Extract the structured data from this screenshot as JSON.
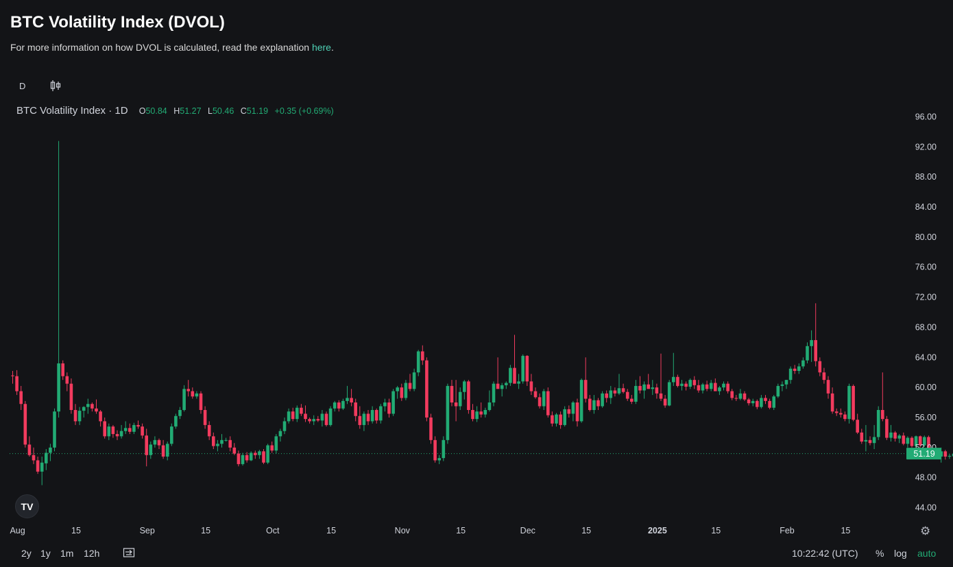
{
  "header": {
    "title": "BTC Volatility Index (DVOL)",
    "subtitle_text": "For more information on how DVOL is calculated, read the explanation ",
    "subtitle_link": "here",
    "subtitle_end": "."
  },
  "toolbar": {
    "interval": "D",
    "chart_type_icon": "candlestick-icon"
  },
  "legend": {
    "symbol": "BTC Volatility Index · 1D",
    "o_label": "O",
    "o": "50.84",
    "h_label": "H",
    "h": "51.27",
    "l_label": "L",
    "l": "50.46",
    "c_label": "C",
    "c": "51.19",
    "change": "+0.35 (+0.69%)"
  },
  "last_price": "51.19",
  "colors": {
    "up": "#22ab74",
    "down": "#f23b5e",
    "background": "#131417",
    "link": "#4fd1b5"
  },
  "bottom_bar": {
    "ranges": [
      "2y",
      "1y",
      "1m",
      "12h"
    ],
    "goto_icon": "go-to-date-icon",
    "time": "10:22:42 (UTC)",
    "percent": "%",
    "log": "log",
    "auto": "auto",
    "settings_icon": "gear-icon",
    "logo": "TV"
  },
  "chart_data": {
    "type": "candlestick",
    "y_ticks": [
      "96.00",
      "92.00",
      "88.00",
      "84.00",
      "80.00",
      "76.00",
      "72.00",
      "68.00",
      "64.00",
      "60.00",
      "56.00",
      "52.00",
      "48.00",
      "44.00"
    ],
    "ylim": [
      42.5,
      97.5
    ],
    "x_ticks": [
      {
        "label": "Aug",
        "day": 1
      },
      {
        "label": "15",
        "day": 15
      },
      {
        "label": "Sep",
        "day": 32
      },
      {
        "label": "15",
        "day": 46
      },
      {
        "label": "Oct",
        "day": 62
      },
      {
        "label": "15",
        "day": 76
      },
      {
        "label": "Nov",
        "day": 93
      },
      {
        "label": "15",
        "day": 107
      },
      {
        "label": "Dec",
        "day": 123
      },
      {
        "label": "15",
        "day": 137
      },
      {
        "label": "2025",
        "day": 154,
        "bold": true
      },
      {
        "label": "15",
        "day": 168
      },
      {
        "label": "Feb",
        "day": 185
      },
      {
        "label": "15",
        "day": 199
      }
    ],
    "x_axis_note": "day index counted from Jul 31 2024 = 0",
    "candles": [
      [
        61.6,
        62.2,
        60.5,
        61.5
      ],
      [
        61.5,
        62.3,
        59.0,
        59.5
      ],
      [
        59.5,
        60.2,
        57.0,
        57.8
      ],
      [
        57.8,
        58.2,
        52.0,
        52.4
      ],
      [
        52.4,
        53.5,
        50.8,
        51.0
      ],
      [
        51.0,
        52.0,
        49.8,
        50.3
      ],
      [
        50.3,
        50.8,
        48.5,
        48.8
      ],
      [
        48.8,
        50.8,
        47.0,
        50.0
      ],
      [
        49.9,
        51.8,
        49.0,
        51.3
      ],
      [
        51.3,
        52.5,
        50.2,
        52.0
      ],
      [
        52.0,
        57.2,
        51.5,
        56.8
      ],
      [
        56.8,
        92.8,
        56.0,
        63.2
      ],
      [
        63.2,
        63.6,
        61.0,
        61.5
      ],
      [
        61.5,
        62.0,
        59.5,
        60.5
      ],
      [
        60.5,
        61.2,
        56.5,
        57.0
      ],
      [
        57.0,
        57.8,
        55.0,
        55.5
      ],
      [
        55.5,
        57.4,
        55.0,
        56.9
      ],
      [
        56.9,
        57.5,
        56.0,
        57.4
      ],
      [
        57.4,
        58.5,
        56.5,
        57.8
      ],
      [
        57.8,
        58.0,
        56.8,
        57.2
      ],
      [
        57.2,
        58.4,
        56.5,
        56.8
      ],
      [
        56.8,
        57.0,
        54.8,
        55.5
      ],
      [
        55.5,
        56.0,
        53.2,
        53.5
      ],
      [
        53.5,
        55.2,
        53.0,
        54.8
      ],
      [
        54.8,
        55.0,
        53.3,
        53.8
      ],
      [
        53.8,
        54.3,
        53.0,
        53.5
      ],
      [
        53.5,
        55.0,
        53.2,
        54.2
      ],
      [
        54.2,
        55.5,
        53.8,
        54.6
      ],
      [
        54.6,
        55.2,
        53.8,
        54.1
      ],
      [
        54.1,
        55.3,
        53.8,
        55.0
      ],
      [
        55.0,
        55.6,
        54.5,
        54.8
      ],
      [
        54.8,
        55.2,
        53.2,
        53.6
      ],
      [
        53.6,
        54.5,
        49.5,
        51.0
      ],
      [
        51.0,
        52.8,
        50.5,
        52.4
      ],
      [
        52.4,
        53.5,
        52.0,
        53.0
      ],
      [
        53.0,
        53.2,
        51.8,
        52.3
      ],
      [
        52.3,
        53.0,
        50.5,
        50.8
      ],
      [
        50.8,
        52.8,
        50.3,
        52.5
      ],
      [
        52.5,
        55.2,
        52.2,
        54.8
      ],
      [
        54.8,
        56.5,
        54.5,
        56.2
      ],
      [
        56.2,
        57.4,
        55.8,
        57.0
      ],
      [
        57.0,
        60.3,
        56.8,
        59.8
      ],
      [
        59.8,
        61.0,
        58.8,
        59.5
      ],
      [
        59.5,
        60.0,
        58.5,
        58.8
      ],
      [
        58.8,
        59.5,
        58.5,
        59.2
      ],
      [
        59.2,
        59.5,
        56.5,
        57.0
      ],
      [
        57.0,
        57.5,
        54.5,
        55.0
      ],
      [
        55.0,
        55.5,
        53.0,
        53.5
      ],
      [
        53.5,
        54.0,
        51.8,
        52.2
      ],
      [
        52.2,
        53.0,
        51.5,
        52.5
      ],
      [
        52.5,
        53.8,
        52.0,
        53.0
      ],
      [
        53.0,
        53.3,
        52.8,
        53.0
      ],
      [
        53.0,
        53.5,
        51.5,
        52.0
      ],
      [
        52.0,
        52.6,
        51.0,
        51.2
      ],
      [
        51.2,
        51.6,
        49.5,
        49.8
      ],
      [
        49.8,
        51.3,
        49.6,
        51.0
      ],
      [
        51.0,
        51.4,
        50.0,
        50.3
      ],
      [
        50.3,
        51.5,
        50.2,
        51.3
      ],
      [
        51.3,
        51.6,
        50.5,
        51.0
      ],
      [
        51.0,
        51.7,
        50.5,
        51.5
      ],
      [
        51.5,
        51.8,
        49.8,
        50.0
      ],
      [
        50.0,
        52.5,
        49.8,
        52.3
      ],
      [
        52.3,
        52.8,
        51.3,
        51.6
      ],
      [
        51.6,
        53.8,
        51.2,
        53.5
      ],
      [
        53.5,
        54.5,
        52.8,
        54.2
      ],
      [
        54.2,
        56.0,
        53.8,
        55.5
      ],
      [
        55.5,
        57.2,
        55.2,
        56.8
      ],
      [
        56.8,
        57.3,
        55.5,
        55.8
      ],
      [
        55.8,
        57.6,
        55.4,
        57.3
      ],
      [
        57.3,
        57.8,
        56.2,
        56.5
      ],
      [
        56.5,
        57.6,
        55.4,
        55.8
      ],
      [
        55.8,
        56.0,
        55.2,
        55.5
      ],
      [
        55.5,
        56.3,
        55.0,
        55.8
      ],
      [
        55.8,
        56.2,
        55.4,
        55.6
      ],
      [
        55.6,
        57.0,
        54.8,
        56.5
      ],
      [
        56.5,
        56.8,
        54.8,
        55.0
      ],
      [
        55.0,
        57.5,
        54.8,
        57.2
      ],
      [
        57.2,
        58.2,
        56.8,
        58.0
      ],
      [
        58.0,
        58.3,
        56.8,
        57.2
      ],
      [
        57.2,
        58.5,
        57.0,
        58.2
      ],
      [
        58.2,
        60.2,
        57.8,
        58.6
      ],
      [
        58.6,
        59.8,
        57.5,
        58.0
      ],
      [
        58.0,
        58.5,
        55.5,
        56.2
      ],
      [
        56.2,
        57.5,
        54.5,
        55.0
      ],
      [
        55.0,
        56.8,
        54.2,
        56.5
      ],
      [
        56.5,
        57.0,
        55.0,
        55.5
      ],
      [
        55.5,
        57.5,
        55.2,
        57.0
      ],
      [
        57.0,
        57.2,
        55.2,
        55.6
      ],
      [
        55.6,
        57.8,
        55.2,
        57.5
      ],
      [
        57.5,
        58.5,
        56.8,
        58.0
      ],
      [
        58.0,
        58.5,
        56.0,
        56.5
      ],
      [
        56.5,
        59.8,
        56.2,
        59.5
      ],
      [
        59.5,
        60.2,
        58.5,
        60.0
      ],
      [
        60.0,
        60.5,
        58.2,
        58.6
      ],
      [
        58.6,
        61.0,
        58.3,
        60.6
      ],
      [
        60.6,
        61.8,
        59.5,
        59.8
      ],
      [
        59.8,
        62.5,
        59.5,
        62.0
      ],
      [
        62.0,
        65.0,
        61.5,
        64.8
      ],
      [
        64.8,
        65.6,
        63.0,
        63.6
      ],
      [
        63.6,
        64.0,
        55.5,
        56.0
      ],
      [
        56.0,
        56.5,
        52.5,
        53.0
      ],
      [
        53.0,
        53.5,
        50.0,
        50.3
      ],
      [
        50.3,
        51.0,
        49.8,
        50.6
      ],
      [
        50.6,
        53.5,
        50.2,
        53.0
      ],
      [
        53.0,
        60.5,
        52.5,
        60.2
      ],
      [
        60.2,
        61.0,
        57.5,
        58.0
      ],
      [
        58.0,
        61.0,
        55.5,
        57.5
      ],
      [
        57.5,
        60.0,
        57.0,
        59.4
      ],
      [
        59.4,
        61.0,
        58.4,
        60.8
      ],
      [
        60.8,
        61.0,
        56.5,
        57.0
      ],
      [
        57.0,
        57.8,
        55.5,
        55.8
      ],
      [
        55.8,
        57.5,
        55.4,
        56.8
      ],
      [
        56.8,
        58.0,
        56.0,
        56.4
      ],
      [
        56.4,
        57.3,
        56.0,
        57.0
      ],
      [
        57.0,
        59.6,
        56.8,
        58.0
      ],
      [
        58.0,
        60.8,
        57.5,
        60.5
      ],
      [
        60.5,
        64.0,
        60.2,
        59.8
      ],
      [
        59.8,
        60.6,
        58.8,
        60.3
      ],
      [
        60.3,
        60.8,
        59.8,
        60.6
      ],
      [
        60.6,
        63.0,
        60.2,
        62.6
      ],
      [
        62.6,
        67.0,
        62.2,
        60.5
      ],
      [
        60.5,
        61.8,
        59.8,
        60.8
      ],
      [
        60.8,
        64.4,
        60.5,
        64.2
      ],
      [
        64.2,
        64.3,
        60.2,
        60.8
      ],
      [
        60.8,
        61.8,
        59.0,
        59.5
      ],
      [
        59.5,
        60.0,
        58.5,
        58.7
      ],
      [
        58.7,
        59.2,
        57.2,
        57.5
      ],
      [
        57.5,
        59.8,
        57.0,
        59.5
      ],
      [
        59.5,
        60.0,
        56.0,
        56.3
      ],
      [
        56.3,
        56.8,
        54.8,
        55.2
      ],
      [
        55.2,
        56.6,
        54.8,
        56.4
      ],
      [
        56.4,
        56.8,
        54.5,
        55.0
      ],
      [
        55.0,
        57.5,
        54.8,
        57.1
      ],
      [
        57.1,
        57.6,
        56.0,
        56.5
      ],
      [
        56.5,
        58.2,
        55.5,
        58.0
      ],
      [
        58.0,
        58.5,
        54.8,
        55.5
      ],
      [
        55.5,
        61.2,
        55.3,
        61.0
      ],
      [
        61.0,
        64.0,
        58.0,
        58.5
      ],
      [
        58.5,
        59.0,
        56.8,
        57.0
      ],
      [
        57.0,
        59.0,
        56.5,
        58.3
      ],
      [
        58.3,
        58.6,
        57.0,
        57.5
      ],
      [
        57.5,
        59.5,
        57.3,
        59.2
      ],
      [
        59.2,
        59.6,
        58.0,
        58.6
      ],
      [
        58.6,
        60.2,
        57.8,
        59.6
      ],
      [
        59.6,
        60.0,
        58.8,
        59.2
      ],
      [
        59.2,
        61.8,
        59.0,
        59.9
      ],
      [
        59.9,
        60.5,
        59.2,
        59.4
      ],
      [
        59.4,
        59.8,
        58.2,
        58.5
      ],
      [
        58.5,
        59.0,
        57.8,
        58.1
      ],
      [
        58.1,
        61.0,
        57.8,
        60.2
      ],
      [
        60.2,
        61.5,
        59.2,
        59.6
      ],
      [
        59.6,
        60.8,
        58.5,
        60.4
      ],
      [
        60.4,
        61.8,
        60.0,
        59.8
      ],
      [
        59.8,
        61.0,
        59.0,
        60.0
      ],
      [
        60.0,
        60.5,
        58.5,
        59.2
      ],
      [
        59.2,
        64.5,
        58.2,
        58.5
      ],
      [
        58.5,
        59.0,
        57.3,
        57.6
      ],
      [
        57.6,
        61.0,
        57.5,
        60.7
      ],
      [
        60.7,
        64.6,
        60.2,
        61.4
      ],
      [
        61.4,
        61.7,
        60.0,
        60.2
      ],
      [
        60.2,
        61.0,
        59.6,
        60.5
      ],
      [
        60.5,
        60.8,
        59.6,
        60.1
      ],
      [
        60.1,
        61.2,
        59.8,
        61.0
      ],
      [
        61.0,
        61.5,
        59.8,
        60.3
      ],
      [
        60.3,
        61.0,
        59.3,
        59.6
      ],
      [
        59.6,
        60.6,
        59.2,
        60.4
      ],
      [
        60.4,
        60.9,
        59.5,
        59.8
      ],
      [
        59.8,
        61.0,
        59.5,
        60.6
      ],
      [
        60.6,
        61.2,
        59.7,
        59.5
      ],
      [
        59.5,
        60.2,
        59.0,
        60.0
      ],
      [
        60.0,
        60.8,
        59.6,
        60.5
      ],
      [
        60.5,
        60.8,
        59.2,
        59.5
      ],
      [
        59.5,
        59.8,
        58.3,
        58.6
      ],
      [
        58.6,
        59.0,
        58.2,
        58.5
      ],
      [
        58.5,
        59.8,
        58.3,
        59.2
      ],
      [
        59.2,
        59.5,
        58.2,
        58.4
      ],
      [
        58.4,
        58.6,
        57.6,
        57.9
      ],
      [
        57.9,
        58.5,
        57.5,
        58.2
      ],
      [
        58.2,
        58.4,
        57.1,
        57.4
      ],
      [
        57.4,
        59.0,
        57.2,
        58.6
      ],
      [
        58.6,
        59.0,
        57.8,
        58.2
      ],
      [
        58.2,
        58.5,
        57.1,
        57.3
      ],
      [
        57.3,
        59.0,
        57.0,
        58.8
      ],
      [
        58.8,
        60.5,
        58.6,
        60.2
      ],
      [
        60.2,
        60.8,
        59.5,
        60.4
      ],
      [
        60.4,
        61.0,
        59.8,
        61.0
      ],
      [
        61.0,
        62.8,
        60.5,
        62.5
      ],
      [
        62.5,
        63.0,
        61.8,
        62.2
      ],
      [
        62.2,
        63.2,
        61.8,
        62.8
      ],
      [
        62.8,
        64.0,
        62.5,
        63.6
      ],
      [
        63.6,
        66.0,
        63.2,
        65.5
      ],
      [
        65.5,
        67.6,
        63.4,
        66.3
      ],
      [
        66.3,
        71.2,
        62.8,
        63.5
      ],
      [
        63.5,
        64.0,
        61.5,
        62.0
      ],
      [
        62.0,
        62.6,
        60.5,
        61.0
      ],
      [
        61.0,
        61.5,
        58.5,
        59.2
      ],
      [
        59.2,
        60.0,
        56.5,
        56.8
      ],
      [
        56.8,
        57.2,
        56.2,
        56.6
      ],
      [
        56.6,
        57.2,
        56.0,
        56.4
      ],
      [
        56.4,
        56.8,
        55.5,
        55.8
      ],
      [
        55.8,
        60.5,
        55.2,
        60.2
      ],
      [
        60.2,
        60.4,
        55.5,
        55.7
      ],
      [
        55.7,
        56.5,
        53.8,
        54.0
      ],
      [
        54.0,
        54.5,
        52.5,
        52.8
      ],
      [
        52.8,
        55.0,
        51.5,
        53.0
      ],
      [
        53.0,
        53.5,
        52.3,
        52.6
      ],
      [
        52.6,
        55.0,
        51.8,
        53.4
      ],
      [
        53.4,
        57.5,
        53.0,
        57.0
      ],
      [
        57.0,
        62.0,
        55.5,
        55.8
      ],
      [
        55.8,
        56.2,
        53.0,
        53.3
      ],
      [
        53.3,
        55.0,
        52.8,
        54.0
      ],
      [
        54.0,
        54.2,
        52.8,
        53.2
      ],
      [
        53.2,
        53.8,
        52.6,
        53.6
      ],
      [
        53.6,
        54.0,
        52.3,
        52.5
      ],
      [
        52.5,
        53.5,
        52.0,
        53.3
      ],
      [
        53.3,
        53.5,
        52.0,
        52.2
      ],
      [
        52.2,
        53.6,
        51.8,
        53.5
      ],
      [
        53.5,
        53.6,
        52.0,
        52.3
      ],
      [
        52.3,
        53.6,
        52.1,
        53.4
      ],
      [
        53.4,
        53.6,
        50.8,
        51.1
      ],
      [
        51.1,
        52.0,
        50.8,
        51.6
      ],
      [
        51.6,
        51.8,
        50.6,
        50.8
      ],
      [
        50.8,
        52.0,
        50.0,
        51.5
      ],
      [
        51.5,
        51.7,
        50.4,
        50.8
      ],
      [
        50.8,
        51.2,
        50.5,
        50.9
      ],
      [
        50.84,
        51.27,
        50.46,
        51.19
      ]
    ]
  }
}
